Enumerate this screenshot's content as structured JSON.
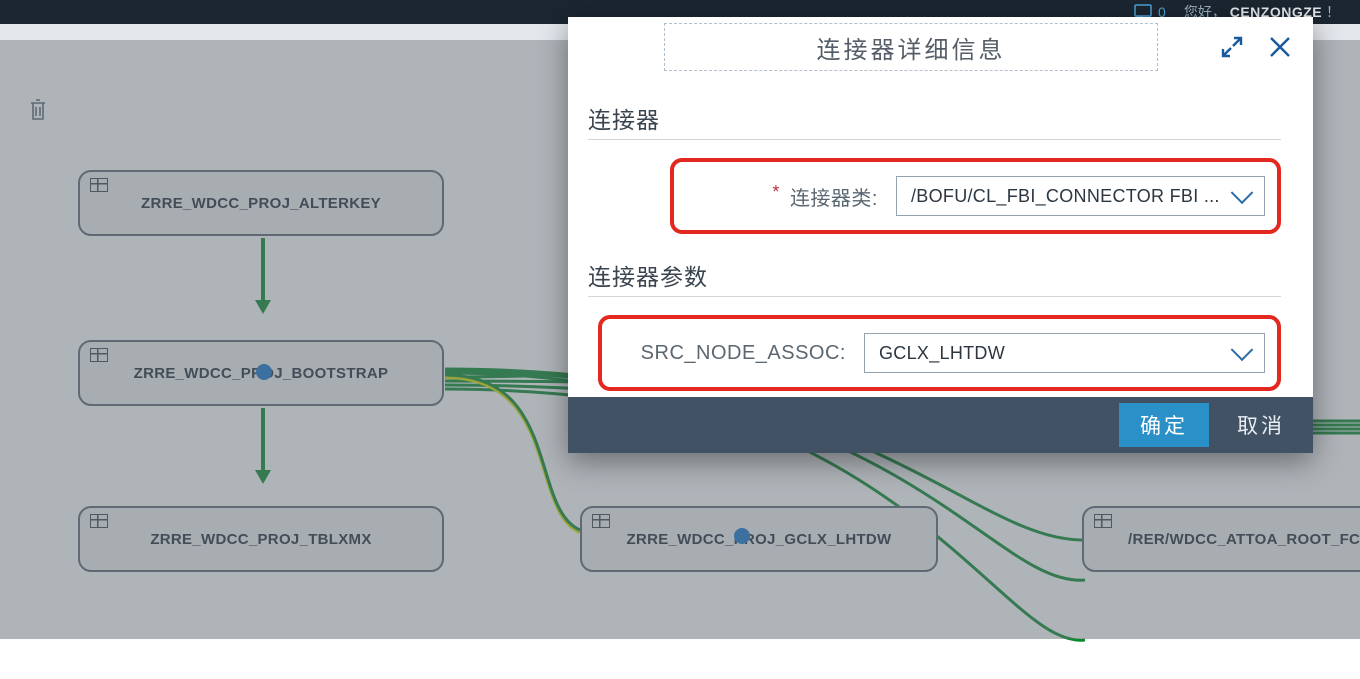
{
  "header": {
    "msg_count": "0",
    "greet_prefix": "您好，",
    "user": "CENZONGZE",
    "greet_suffix": "！"
  },
  "nodes": {
    "n1": "ZRRE_WDCC_PROJ_ALTERKEY",
    "n2": "ZRRE_WDCC_PROJ_BOOTSTRAP",
    "n3": "ZRRE_WDCC_PROJ_TBLXMX",
    "n4": "ZRRE_WDCC_PROJ_GCLX_LHTDW",
    "n5": "/RER/WDCC_ATTOA_ROOT_FC"
  },
  "dialog": {
    "title": "连接器详细信息",
    "section1_title": "连接器",
    "section2_title": "连接器参数",
    "field1_label": "连接器类:",
    "field1_value": "/BOFU/CL_FBI_CONNECTOR FBI ...",
    "field2_label": "SRC_NODE_ASSOC:",
    "field2_value": "GCLX_LHTDW",
    "btn_ok": "确定",
    "btn_cancel": "取消"
  }
}
